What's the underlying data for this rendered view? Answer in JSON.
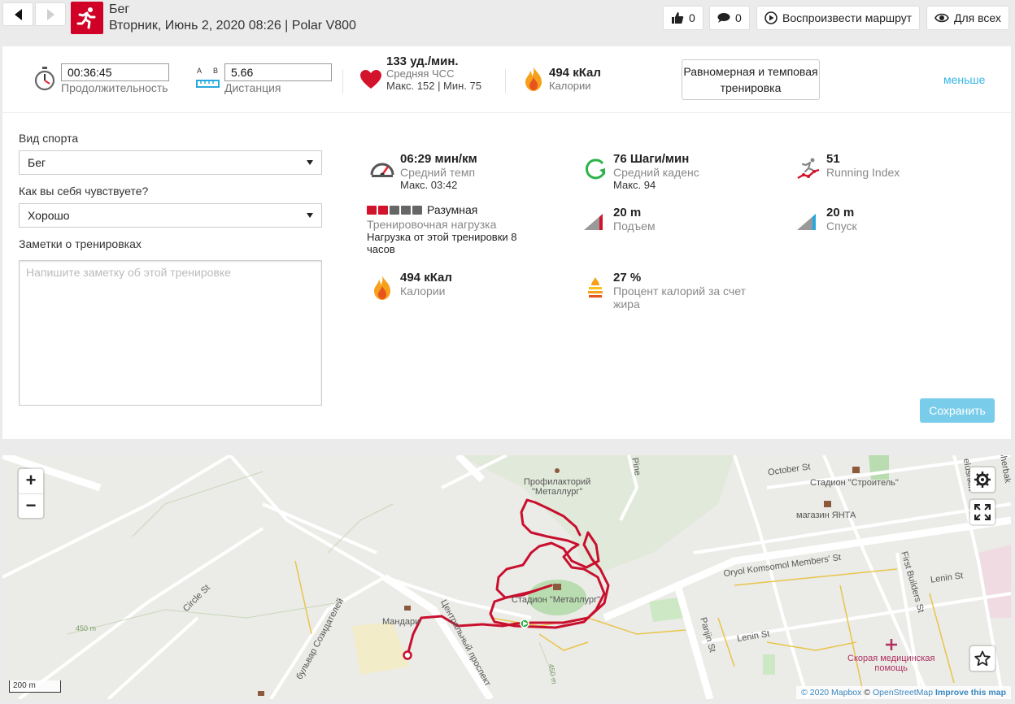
{
  "header": {
    "sport": "Бег",
    "subtitle": "Вторник, Июнь 2, 2020 08:26 | Polar V800",
    "likes": "0",
    "comments": "0",
    "play_route": "Воспроизвести маршрут",
    "visibility": "Для всех"
  },
  "summary": {
    "duration_value": "00:36:45",
    "duration_label": "Продолжительность",
    "distance_a": "A",
    "distance_b": "B",
    "distance_value": "5.66",
    "distance_label": "Дистанция",
    "hr_value": "133 уд./мин.",
    "hr_label": "Средняя ЧСС",
    "hr_minmax": "Макс. 152  |  Мин. 75",
    "calories_value": "494 кКал",
    "calories_label": "Калории",
    "workout_type": "Равномерная и темповая тренировка",
    "less": "меньше"
  },
  "form": {
    "sport_label": "Вид спорта",
    "sport_value": "Бег",
    "feeling_label": "Как вы себя чувствуете?",
    "feeling_value": "Хорошо",
    "notes_label": "Заметки о тренировках",
    "notes_placeholder": "Напишите заметку об этой тренировке",
    "save": "Сохранить"
  },
  "stats": {
    "pace_value": "06:29 мин/км",
    "pace_label": "Средний темп",
    "pace_max": "Макс. 03:42",
    "cadence_value": "76 Шаги/мин",
    "cadence_label": "Средний каденс",
    "cadence_max": "Макс. 94",
    "running_index_value": "51",
    "running_index_label": "Running Index",
    "load_level": "Разумная",
    "load_label": "Тренировочная нагрузка",
    "load_desc": "Нагрузка от этой тренировки 8 часов",
    "ascent_value": "20 m",
    "ascent_label": "Подъем",
    "descent_value": "20 m",
    "descent_label": "Спуск",
    "calories_value": "494 кКал",
    "calories_label": "Калории",
    "fat_value": "27 %",
    "fat_label": "Процент калорий за счет жира"
  },
  "map": {
    "zoom_in": "+",
    "zoom_out": "−",
    "scale": "200 m",
    "attrib_mapbox": "© 2020 Mapbox",
    "attrib_osm": "OpenStreetMap",
    "attrib_improve": "Improve this map",
    "labels": {
      "profilaktory": "Профилакторий",
      "metallurg": "\"Металлург\"",
      "stadium": "Стадион \"Металлург\"",
      "stroitel": "Стадион \"Строитель\"",
      "yanta": "магазин ЯНТА",
      "october": "October St",
      "oryol": "Oryol Komsomol Members' St",
      "lenin1": "Lenin St",
      "lenin2": "Lenin St",
      "first_builders": "First Builders St",
      "panjin": "Panjin St",
      "circle": "Circle St",
      "boulevard": "бульвар Созидателей",
      "central": "Центральный проспект",
      "mandari": "Мандари",
      "ambulance": "Скорая медицинская",
      "ambulance2": "помощь",
      "elev1": "450 m",
      "elev2": "450 m",
      "pine": "Pine",
      "belushkin": "elushkin",
      "sherbak": "Sherbak"
    }
  },
  "colors": {
    "brand_red": "#d10027",
    "link_blue": "#36b4e5",
    "save_bg": "#79cdeb",
    "route": "#c8102e"
  }
}
